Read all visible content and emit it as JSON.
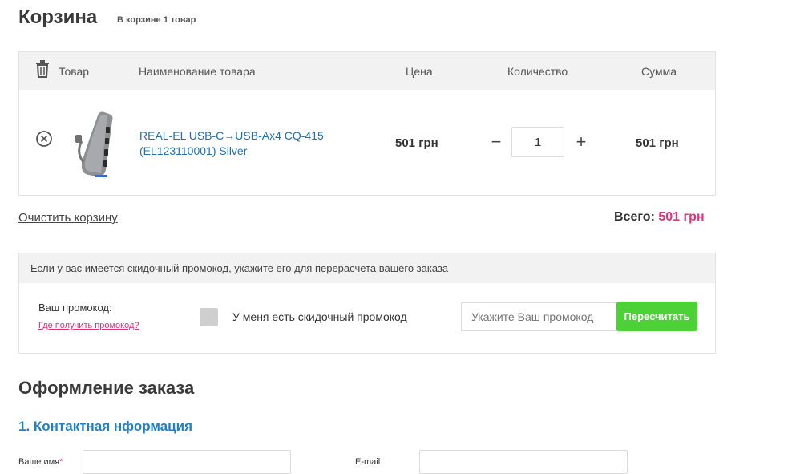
{
  "header": {
    "title": "Корзина",
    "count_text": "В корзине 1 товар"
  },
  "table": {
    "col_product": "Товар",
    "col_name": "Наименование товара",
    "col_price": "Цена",
    "col_qty": "Количество",
    "col_sum": "Сумма"
  },
  "items": [
    {
      "name": "REAL-EL USB-C→USB-Ax4 CQ-415 (EL123110001) Silver",
      "price": "501 грн",
      "qty": "1",
      "sum": "501 грн"
    }
  ],
  "cart": {
    "clear_label": "Очистить корзину",
    "total_label": "Всего:",
    "total_value": "501 грн"
  },
  "promo": {
    "header": "Если у вас имеется скидочный промокод, укажите его для перерасчета вашего заказа",
    "label": "Ваш промокод:",
    "link": "Где получить промокод?",
    "checkbox_label": "У меня есть скидочный промокод",
    "placeholder": "Укажите Ваш промокод",
    "button": "Пересчитать"
  },
  "checkout": {
    "title": "Оформление заказа",
    "section1": "1. Контактная нформация",
    "name_label": "Ваше имя",
    "required_mark": "*",
    "email_label": "E-mail"
  },
  "colors": {
    "accent_pink": "#e3307a",
    "link_blue": "#1f6fb5",
    "button_green": "#4cd137"
  },
  "icons": {
    "trash": "trash-icon",
    "remove": "remove-circle-icon",
    "minus": "minus-icon",
    "plus": "plus-icon"
  }
}
